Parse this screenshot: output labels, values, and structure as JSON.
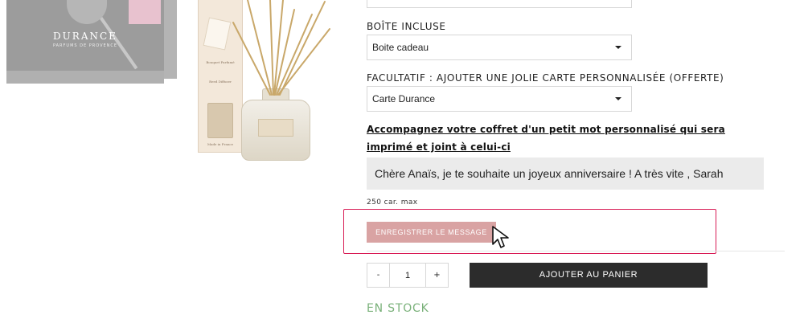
{
  "product_images": {
    "gift_box_brand": "DURANCE",
    "gift_box_subtitle": "PARFUMS DE PROVENCE",
    "diffuser_carton_title": "Bouquet Parfumé",
    "diffuser_carton_subtitle": "Reed Diffuser",
    "diffuser_carton_footer": "Made in France"
  },
  "options": {
    "box_label": "BOÎTE INCLUSE",
    "box_value": "Boite cadeau",
    "card_label": "FACULTATIF : AJOUTER UNE JOLIE CARTE PERSONNALISÉE (OFFERTE)",
    "card_value": "Carte Durance"
  },
  "message": {
    "heading": "Accompagnez votre coffret d'un petit mot personnalisé qui sera imprimé et joint à celui-ci",
    "text": "Chère Anaïs, je te souhaite un joyeux anniversaire ! A très vite , Sarah",
    "limit": "250 car. max",
    "save_label": "ENREGISTRER LE MESSAGE"
  },
  "cart": {
    "minus": "-",
    "quantity": "1",
    "plus": "+",
    "add_label": "AJOUTER AU PANIER",
    "stock_status": "EN STOCK"
  },
  "colors": {
    "save_button": "#d9a3a3",
    "highlight_border": "#d81b55",
    "add_to_cart": "#2c2c2c",
    "stock_text": "#7ab17a"
  },
  "icons": {
    "select_arrow": "chevron-down-icon",
    "pointer": "cursor-arrow-icon"
  }
}
